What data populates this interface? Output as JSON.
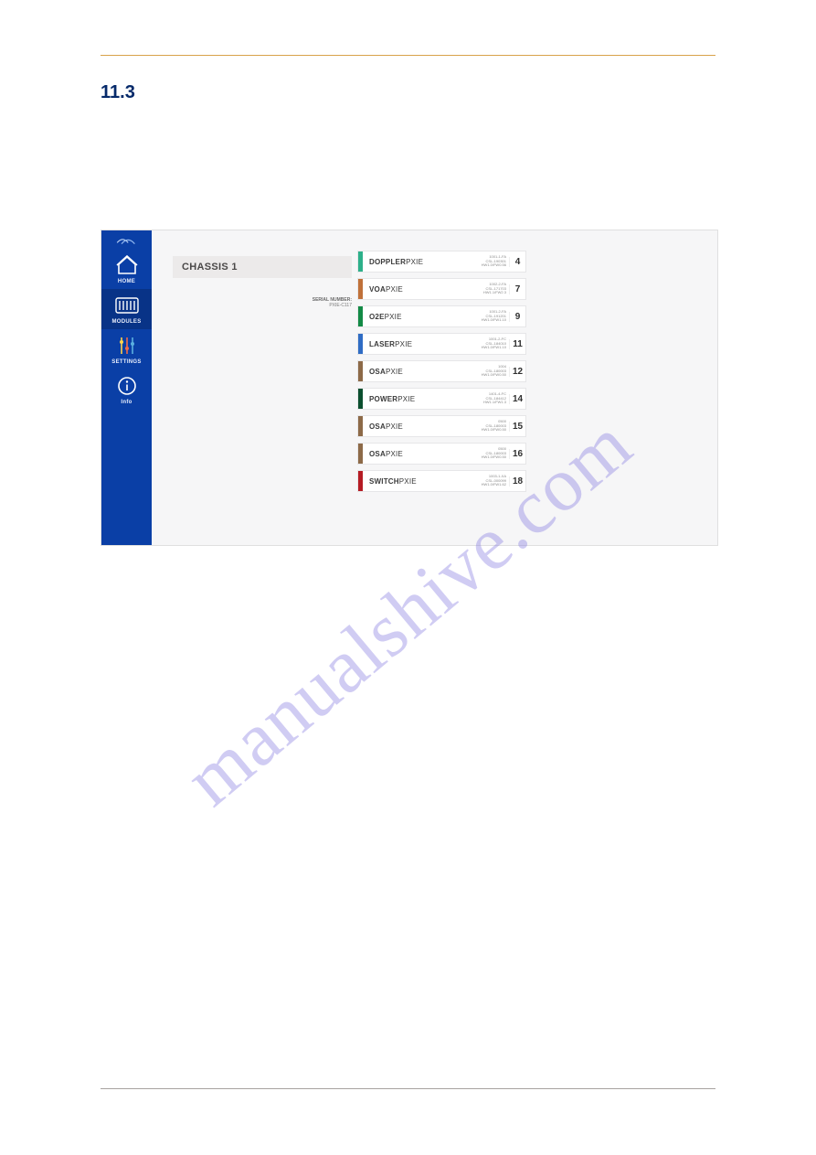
{
  "section_number": "11.3",
  "watermark": "manualshive.com",
  "nav": {
    "items": [
      {
        "label": "HOME"
      },
      {
        "label": "MODULES"
      },
      {
        "label": "SETTINGS"
      },
      {
        "label": "Info"
      }
    ]
  },
  "flyout": [
    {
      "name": "DOPPLER PXIE",
      "sub": "1001-1-FA CSL-190301",
      "slot": "4",
      "color": "#2db08a"
    },
    {
      "name": "VOAPXIE",
      "sub": "1002-2-FA CSL-171703",
      "slot": "7",
      "color": "#c0713a"
    },
    {
      "name": "O2EPXIE",
      "sub": "1001-2-FA CSL-191201",
      "slot": "9",
      "color": "#138a46"
    },
    {
      "name": "LASERPXIE",
      "sub": "1001-2-FC CSL-184010",
      "slot": "11",
      "color": "#2f6cc4"
    },
    {
      "name": "OSAPXIE",
      "sub": "1004 CSL-180003",
      "slot": "12",
      "color": "#8d6a48"
    },
    {
      "name": "POWERPXIE",
      "sub": "1401-4-FC CSL-184412",
      "slot": "14",
      "color": "#0b4f2f"
    },
    {
      "name": "OSAPXIE",
      "sub": "0500 CSL-180003",
      "slot": "15",
      "color": "#8d6a48"
    },
    {
      "name": "OSAPXIE",
      "sub": "0500 CSL-180003",
      "slot": "16",
      "color": "#8d6a48"
    },
    {
      "name": "SWITCHPXIE",
      "sub": "1003-1-XA CSL-000099",
      "slot": "18",
      "color": "#b51c24"
    }
  ],
  "main": {
    "chassis_label": "CHASSIS 1",
    "serial_label": "SERIAL NUMBER:",
    "serial_value": "PXIE-C117",
    "cards": [
      {
        "bold": "DOPPLER",
        "rest": "PXIE",
        "meta1": "1001-1-FA",
        "meta2": "CSL-190301",
        "meta3": "HW1.0/FW0.56",
        "slot": "4",
        "color": "#2db08a"
      },
      {
        "bold": "VOA",
        "rest": "PXIE",
        "meta1": "1002-2-FA",
        "meta2": "CSL-171703",
        "meta3": "HW1.1/FW2.3",
        "slot": "7",
        "color": "#c0713a"
      },
      {
        "bold": "O2E",
        "rest": "PXIE",
        "meta1": "1001-2-FA",
        "meta2": "CSL-191201",
        "meta3": "HW1.0/FW1.10",
        "slot": "9",
        "color": "#138a46"
      },
      {
        "bold": "LASER",
        "rest": "PXIE",
        "meta1": "1001-2-FC",
        "meta2": "CSL-184010",
        "meta3": "HW1.0/FW1.10",
        "slot": "11",
        "color": "#2f6cc4"
      },
      {
        "bold": "OSA",
        "rest": "PXIE",
        "meta1": "1004",
        "meta2": "CSL-180003",
        "meta3": "HW1.0/FW0.50",
        "slot": "12",
        "color": "#8d6a48"
      },
      {
        "bold": "POWER",
        "rest": "PXIE",
        "meta1": "1401-4-FC",
        "meta2": "CSL-184412",
        "meta3": "HW1.1/FW1.3",
        "slot": "14",
        "color": "#0b4f2f"
      },
      {
        "bold": "OSA",
        "rest": "PXIE",
        "meta1": "0500",
        "meta2": "CSL-180003",
        "meta3": "HW1.0/FW0.50",
        "slot": "15",
        "color": "#8d6a48"
      },
      {
        "bold": "OSA",
        "rest": "PXIE",
        "meta1": "0500",
        "meta2": "CSL-180003",
        "meta3": "HW1.0/FW0.50",
        "slot": "16",
        "color": "#8d6a48"
      },
      {
        "bold": "SWITCH",
        "rest": "PXIE",
        "meta1": "1003-1-XA",
        "meta2": "CSL-000099",
        "meta3": "HW1.0/FW1.62",
        "slot": "18",
        "color": "#b51c24"
      }
    ]
  }
}
